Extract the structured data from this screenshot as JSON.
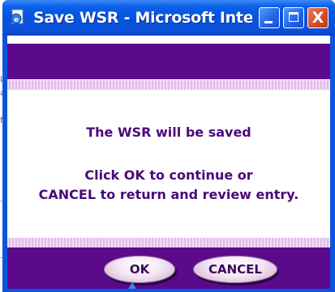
{
  "window": {
    "title": "Save WSR - Microsoft Interne...",
    "title_icon": "ie-document-icon",
    "controls": {
      "minimize_icon": "minimize-icon",
      "maximize_icon": "maximize-icon",
      "close_glyph": "X"
    }
  },
  "background": {
    "mark_1": "L",
    "mark_2": "a",
    "mark_3": "f"
  },
  "dialog": {
    "message": "The WSR will be saved",
    "instruction_line_1": "Click OK to continue or",
    "instruction_line_2": "CANCEL to return and review entry.",
    "ok_label": "OK",
    "cancel_label": "CANCEL"
  },
  "colors": {
    "band": "#5a0a8a",
    "text": "#4a0a7a",
    "titlebar": "#0553e0"
  }
}
